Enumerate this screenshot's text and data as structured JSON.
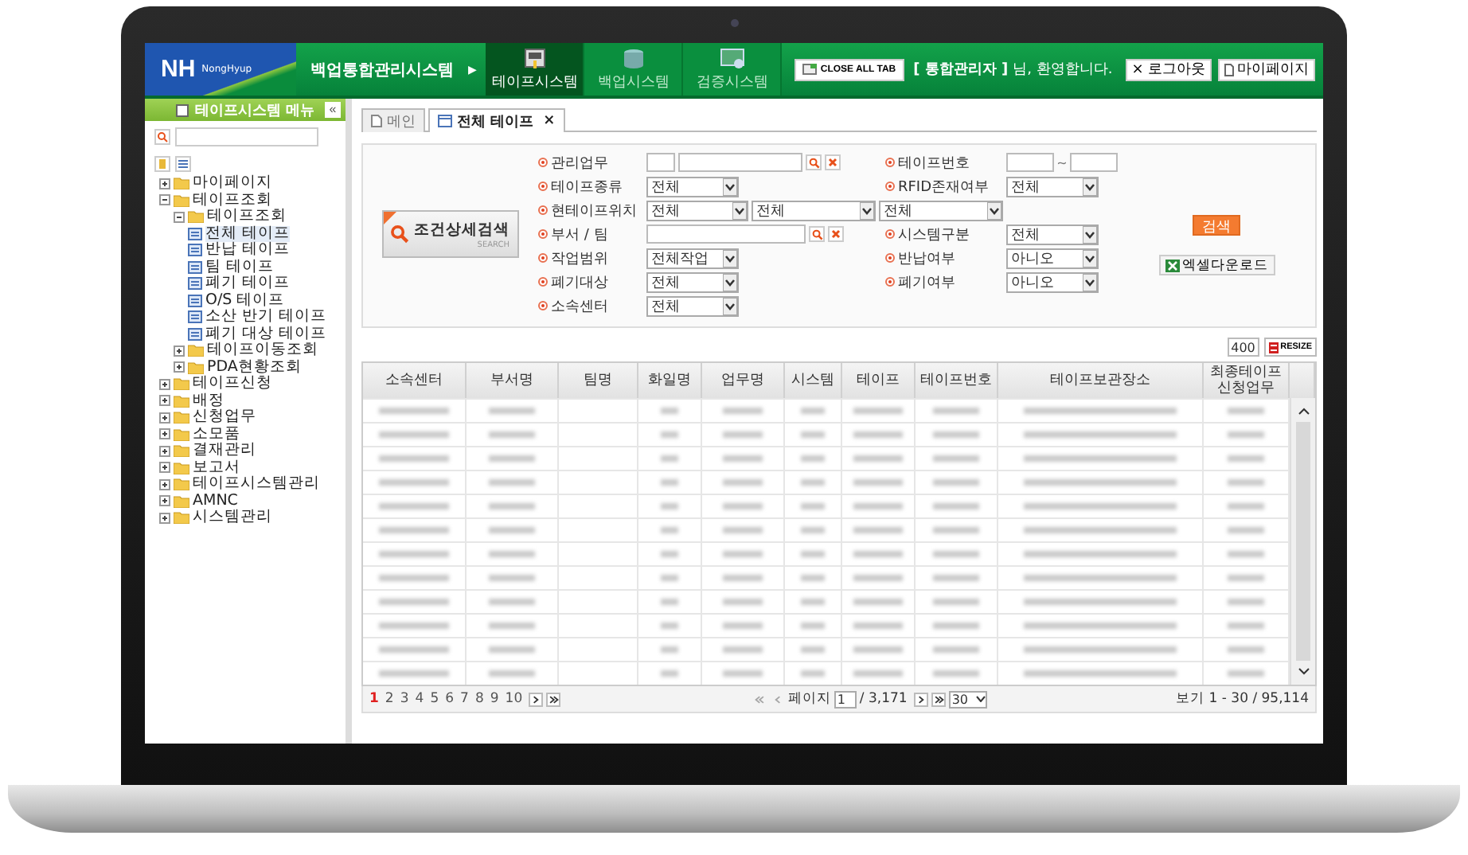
{
  "header": {
    "logo": "NH",
    "logo_sub": "NongHyup",
    "title": "백업통합관리시스템",
    "title_arrow": "▶",
    "modules": [
      {
        "label": "테이프시스템",
        "selected": true
      },
      {
        "label": "백업시스템",
        "selected": false
      },
      {
        "label": "검증시스템",
        "selected": false
      }
    ],
    "close_all": "CLOSE ALL TAB",
    "user": "[ 통합관리자 ]",
    "welcome": "님, 환영합니다.",
    "logout_mark": "×",
    "logout": "로그아웃",
    "mypage": "마이페이지"
  },
  "sidebar": {
    "title": "테이프시스템 메뉴",
    "collapse": "«",
    "tree": [
      {
        "label": "마이페이지",
        "expanded": false
      },
      {
        "label": "테이프조회",
        "expanded": true,
        "children": [
          {
            "label": "테이프조회",
            "expanded": true,
            "children": [
              {
                "label": "전체 테이프",
                "selected": true
              },
              {
                "label": "반납 테이프",
                "selected": false
              },
              {
                "label": "팀 테이프",
                "selected": false
              },
              {
                "label": "폐기 테이프",
                "selected": false
              },
              {
                "label": "O/S 테이프",
                "selected": false
              },
              {
                "label": "소산 반기 테이프",
                "selected": false
              },
              {
                "label": "폐기 대상 테이프",
                "selected": false
              }
            ]
          },
          {
            "label": "테이프이동조회",
            "expanded": false
          },
          {
            "label": "PDA현황조회",
            "expanded": false
          }
        ]
      },
      {
        "label": "테이프신청",
        "expanded": false
      },
      {
        "label": "배정",
        "expanded": false
      },
      {
        "label": "신청업무",
        "expanded": false
      },
      {
        "label": "소모품",
        "expanded": false
      },
      {
        "label": "결재관리",
        "expanded": false
      },
      {
        "label": "보고서",
        "expanded": false
      },
      {
        "label": "테이프시스템관리",
        "expanded": false
      },
      {
        "label": "AMNC",
        "expanded": false
      },
      {
        "label": "시스템관리",
        "expanded": false
      }
    ]
  },
  "tabs": [
    {
      "label": "메인",
      "selected": false
    },
    {
      "label": "전체 테이프",
      "selected": true,
      "close": "×"
    }
  ],
  "search_panel": {
    "detail_button": "조건상세검색",
    "detail_sub": "SEARCH",
    "search": "검색",
    "excel": "엑셀다운로드",
    "rows": [
      {
        "left": {
          "label": "관리업무",
          "kind": "code-lookup"
        },
        "right": {
          "label": "테이프번호",
          "kind": "range",
          "separator": "~"
        }
      },
      {
        "left": {
          "label": "테이프종류",
          "kind": "select",
          "values": [
            "전체"
          ]
        },
        "right": {
          "label": "RFID존재여부",
          "kind": "select",
          "values": [
            "전체"
          ]
        }
      },
      {
        "left": {
          "label": "현테이프위치",
          "kind": "select",
          "values": [
            "전체",
            "전체",
            "전체"
          ]
        }
      },
      {
        "left": {
          "label": "부서 / 팀",
          "kind": "lookup"
        },
        "right": {
          "label": "시스템구분",
          "kind": "select",
          "values": [
            "전체"
          ]
        }
      },
      {
        "left": {
          "label": "작업범위",
          "kind": "select",
          "values": [
            "전체작업"
          ]
        },
        "right": {
          "label": "반납여부",
          "kind": "select",
          "values": [
            "아니오"
          ]
        }
      },
      {
        "left": {
          "label": "폐기대상",
          "kind": "select",
          "values": [
            "전체"
          ]
        },
        "right": {
          "label": "폐기여부",
          "kind": "select",
          "values": [
            "아니오"
          ]
        }
      },
      {
        "left": {
          "label": "소속센터",
          "kind": "select",
          "values": [
            "전체"
          ]
        }
      }
    ]
  },
  "resize": {
    "value": "400",
    "button": "RESIZE"
  },
  "table": {
    "columns": [
      "소속센터",
      "부서명",
      "팀명",
      "화일명",
      "업무명",
      "시스템",
      "테이프",
      "테이프번호",
      "테이프보관장소",
      "최종테이프 신청업무"
    ]
  },
  "pagination": {
    "pages": [
      {
        "label": "1",
        "selected": true
      },
      {
        "label": "2",
        "selected": false
      },
      {
        "label": "3",
        "selected": false
      },
      {
        "label": "4",
        "selected": false
      },
      {
        "label": "5",
        "selected": false
      },
      {
        "label": "6",
        "selected": false
      },
      {
        "label": "7",
        "selected": false
      },
      {
        "label": "8",
        "selected": false
      },
      {
        "label": "9",
        "selected": false
      },
      {
        "label": "10",
        "selected": false
      }
    ],
    "page_nav": [
      {
        "kind": "next",
        "disabled": false
      },
      {
        "kind": "last",
        "disabled": false
      }
    ],
    "jump_nav": [
      {
        "kind": "first",
        "disabled": true
      },
      {
        "kind": "prev",
        "disabled": true
      }
    ],
    "page_label": "페이지",
    "page_value": "1",
    "total_pages": "/ 3,171",
    "jump_nav2": [
      {
        "kind": "next",
        "disabled": false
      },
      {
        "kind": "last",
        "disabled": false
      }
    ],
    "per_page": "30",
    "summary": "보기 1 - 30 / 95,114"
  }
}
